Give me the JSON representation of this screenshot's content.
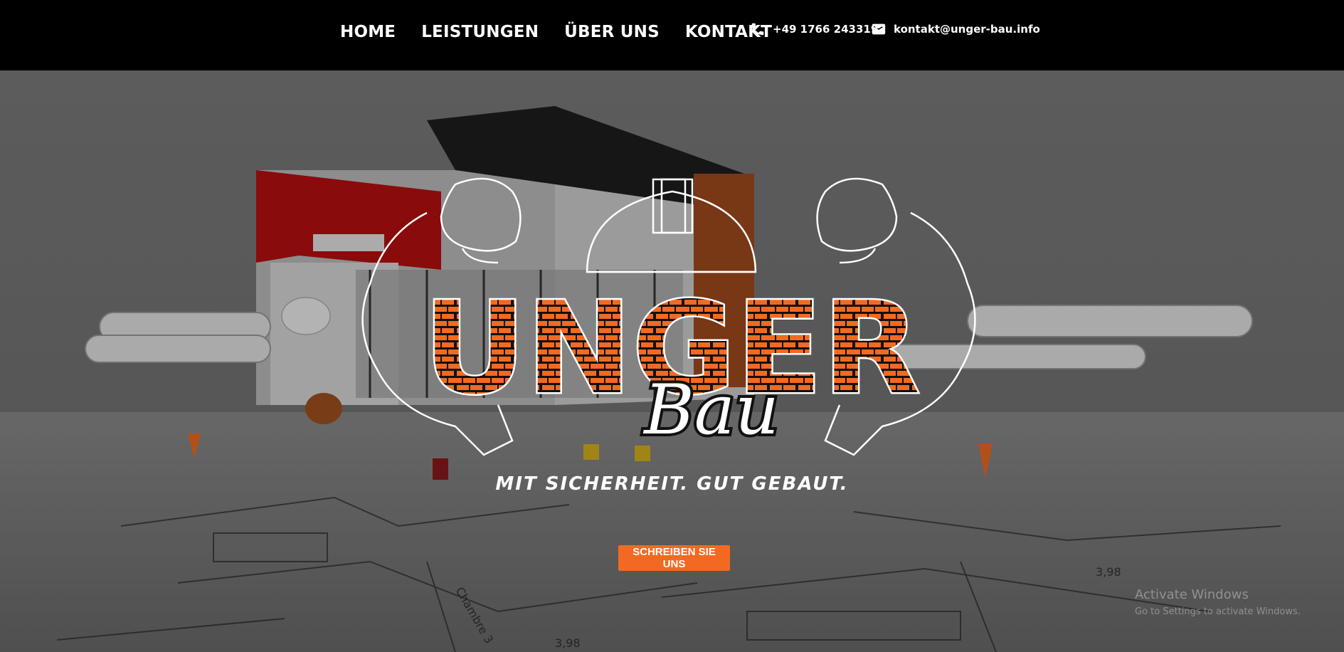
{
  "nav": {
    "items": [
      "HOME",
      "LEISTUNGEN",
      "ÜBER UNS",
      "KONTAKT"
    ]
  },
  "contact": {
    "phone": "+49 1766 2433192",
    "email": "kontakt@unger-bau.info",
    "phone_icon": "phone-icon",
    "email_icon": "mail-icon"
  },
  "hero": {
    "logo_main": "UNGER",
    "logo_script": "Bau",
    "tagline": "MIT SICHERHEIT. GUT GEBAUT.",
    "cta_label": "SCHREIBEN SIE UNS"
  },
  "watermark": {
    "title": "Activate Windows",
    "subtitle": "Go to Settings to activate Windows."
  },
  "colors": {
    "header_bg": "#000000",
    "accent": "#f26a21",
    "hero_overlay": "#6e6e6e"
  }
}
